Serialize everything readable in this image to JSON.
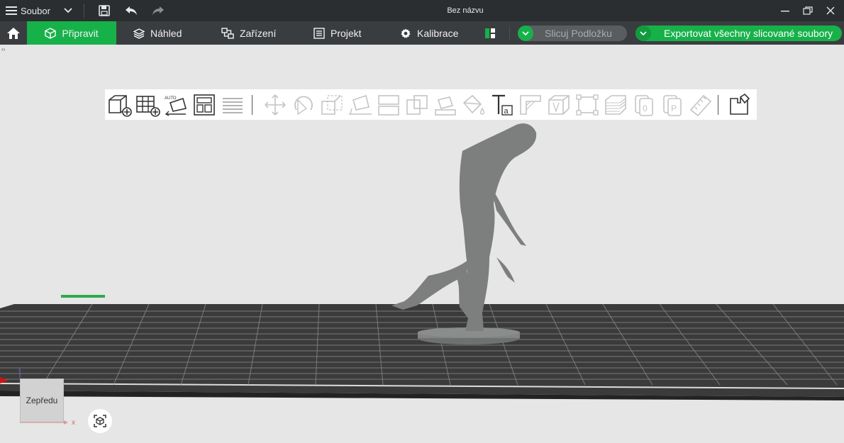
{
  "titlebar": {
    "menu_label": "Soubor",
    "window_title": "Bez názvu"
  },
  "tabs": [
    {
      "label": "Připravit",
      "icon": "cube-icon",
      "active": true
    },
    {
      "label": "Náhled",
      "icon": "layers-icon",
      "active": false
    },
    {
      "label": "Zařízení",
      "icon": "device-icon",
      "active": false
    },
    {
      "label": "Projekt",
      "icon": "list-icon",
      "active": false
    },
    {
      "label": "Kalibrace",
      "icon": "gear-icon",
      "active": false
    }
  ],
  "actions": {
    "slice_plate": "Slicuj Podložku",
    "export_all": "Exportovat všechny slicované soubory"
  },
  "viewport": {
    "view_cube_label": "Zepředu",
    "axis_x": "x",
    "axis_z": "z"
  },
  "colors": {
    "accent": "#17b14a",
    "titlebar_bg": "#2b2e30",
    "menubar_bg": "#3a3d40",
    "canvas_bg": "#e6e6e6",
    "plate": "#3b3b3b"
  },
  "toolbar_icons": [
    "add-object-icon",
    "add-plate-icon",
    "auto-orient-icon",
    "arrange-icon",
    "slice-all-icon",
    "move-icon",
    "rotate-icon",
    "scale-icon",
    "lay-on-face-icon",
    "cut-icon",
    "split-icon",
    "drop-to-bed-icon",
    "paint-icon",
    "text-icon",
    "support-icon",
    "seam-icon",
    "boolean-icon",
    "measure-box-icon",
    "layer-height-icon",
    "zero-icon",
    "p-icon",
    "ruler-icon",
    "assembly-icon"
  ]
}
